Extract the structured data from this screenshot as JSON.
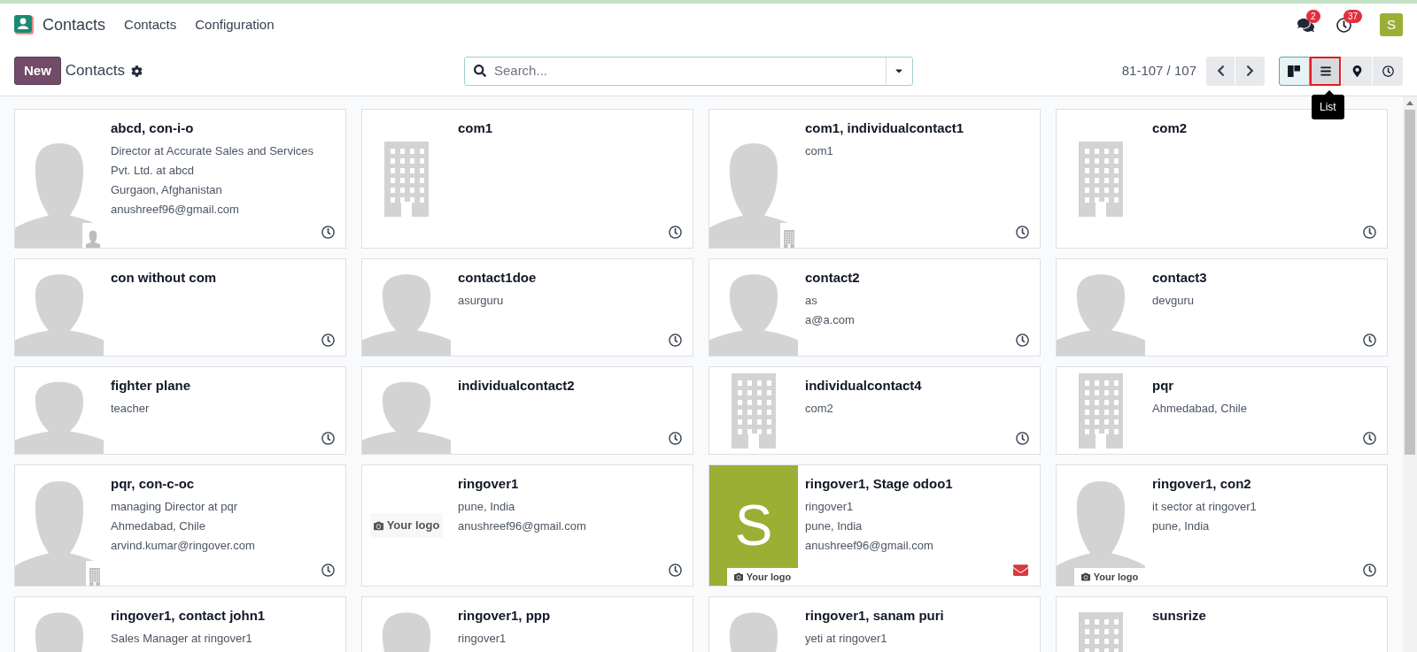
{
  "navbar": {
    "app_name": "Contacts",
    "menu": [
      {
        "label": "Contacts"
      },
      {
        "label": "Configuration"
      }
    ],
    "messages_badge": "2",
    "activities_badge": "37",
    "user_avatar": {
      "letter": "S",
      "color": "#9aaf34"
    }
  },
  "control_panel": {
    "new_button": "New",
    "title": "Contacts",
    "search": {
      "placeholder": "Search..."
    },
    "pager": "81-107 / 107",
    "views": [
      {
        "kind": "kanban",
        "selected": true,
        "hovered": false
      },
      {
        "kind": "list",
        "selected": false,
        "hovered": true
      },
      {
        "kind": "map",
        "selected": false,
        "hovered": false
      },
      {
        "kind": "activity",
        "selected": false,
        "hovered": false
      }
    ],
    "tooltip": "List"
  },
  "cards": [
    {
      "name": "abcd, con-i-o",
      "lines": [
        "Director at Accurate Sales and Services Pvt. Ltd. at abcd",
        "Gurgaon, Afghanistan",
        "anushreef96@gmail.com"
      ],
      "image": {
        "kind": "person",
        "badge": {
          "kind": "person"
        }
      },
      "footer": {
        "kind": "clock"
      }
    },
    {
      "name": "com1",
      "image": {
        "kind": "company"
      },
      "footer": {
        "kind": "clock"
      }
    },
    {
      "name": "com1, individualcontact1",
      "lines": [
        "com1"
      ],
      "image": {
        "kind": "person",
        "badge": {
          "kind": "company"
        }
      },
      "footer": {
        "kind": "clock"
      }
    },
    {
      "name": "com2",
      "image": {
        "kind": "company"
      },
      "footer": {
        "kind": "clock"
      }
    },
    {
      "name": "con without com",
      "image": {
        "kind": "person"
      },
      "footer": {
        "kind": "clock"
      }
    },
    {
      "name": "contact1doe",
      "lines": [
        "asurguru"
      ],
      "image": {
        "kind": "person"
      },
      "footer": {
        "kind": "clock"
      }
    },
    {
      "name": "contact2",
      "lines": [
        "as",
        "a@a.com"
      ],
      "image": {
        "kind": "person"
      },
      "footer": {
        "kind": "clock"
      }
    },
    {
      "name": "contact3",
      "lines": [
        "devguru"
      ],
      "image": {
        "kind": "person"
      },
      "footer": {
        "kind": "clock"
      }
    },
    {
      "name": "fighter plane",
      "lines": [
        "teacher"
      ],
      "image": {
        "kind": "person"
      },
      "footer": {
        "kind": "clock"
      }
    },
    {
      "name": "individualcontact2",
      "image": {
        "kind": "person"
      },
      "footer": {
        "kind": "clock"
      }
    },
    {
      "name": "individualcontact4",
      "lines": [
        "com2"
      ],
      "image": {
        "kind": "company"
      },
      "footer": {
        "kind": "clock"
      }
    },
    {
      "name": "pqr",
      "lines": [
        "Ahmedabad, Chile"
      ],
      "image": {
        "kind": "company"
      },
      "footer": {
        "kind": "clock"
      }
    },
    {
      "name": "pqr, con-c-oc",
      "lines": [
        "managing Director at pqr",
        "Ahmedabad, Chile",
        "arvind.kumar@ringover.com"
      ],
      "image": {
        "kind": "person",
        "badge": {
          "kind": "company"
        }
      },
      "footer": {
        "kind": "clock"
      }
    },
    {
      "name": "ringover1",
      "lines": [
        "pune, India",
        "anushreef96@gmail.com"
      ],
      "image": {
        "kind": "logo",
        "text": "Your logo"
      },
      "footer": {
        "kind": "clock"
      }
    },
    {
      "name": "ringover1, Stage odoo1",
      "lines": [
        "ringover1",
        "pune, India",
        "anushreef96@gmail.com"
      ],
      "image": {
        "kind": "letter",
        "letter": "S",
        "color": "#9aaf34",
        "badge": {
          "kind": "logo",
          "text": "Your logo"
        }
      },
      "footer": {
        "kind": "envelope"
      }
    },
    {
      "name": "ringover1, con2",
      "lines": [
        "it sector at ringover1",
        "pune, India"
      ],
      "image": {
        "kind": "person",
        "badge": {
          "kind": "logo",
          "text": "Your logo"
        }
      },
      "footer": {
        "kind": "clock"
      }
    },
    {
      "name": "ringover1, contact john1",
      "lines": [
        "Sales Manager at ringover1"
      ],
      "image": {
        "kind": "person"
      }
    },
    {
      "name": "ringover1, ppp",
      "lines": [
        "ringover1"
      ],
      "image": {
        "kind": "person"
      }
    },
    {
      "name": "ringover1, sanam puri",
      "lines": [
        "yeti at ringover1"
      ],
      "image": {
        "kind": "person"
      }
    },
    {
      "name": "sunsrize",
      "image": {
        "kind": "company"
      }
    }
  ]
}
